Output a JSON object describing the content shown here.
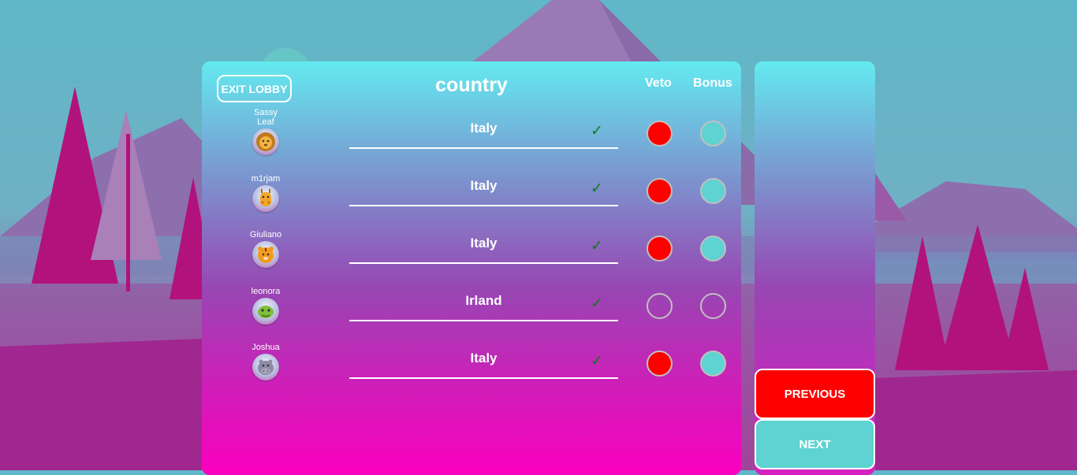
{
  "lobby": {
    "exit_label": "EXIT LOBBY"
  },
  "category": {
    "title": "country"
  },
  "columns": {
    "veto": "Veto",
    "bonus": "Bonus"
  },
  "players": [
    {
      "name": "Sassy\nLeaf",
      "avatar_icon": "lion-icon",
      "answer": "Italy",
      "accepted": true,
      "veto_active": true,
      "bonus_active": true
    },
    {
      "name": "m1rjam",
      "avatar_icon": "giraffe-icon",
      "answer": "Italy",
      "accepted": true,
      "veto_active": true,
      "bonus_active": true
    },
    {
      "name": "Giuliano",
      "avatar_icon": "tiger-icon",
      "answer": "Italy",
      "accepted": true,
      "veto_active": true,
      "bonus_active": true
    },
    {
      "name": "leonora",
      "avatar_icon": "turtle-icon",
      "answer": "Irland",
      "accepted": true,
      "veto_active": false,
      "bonus_active": false
    },
    {
      "name": "Joshua",
      "avatar_icon": "hippo-icon",
      "answer": "Italy",
      "accepted": true,
      "veto_active": true,
      "bonus_active": true
    }
  ],
  "check_symbol": "✓",
  "navigation": {
    "previous_label": "PREVIOUS",
    "next_label": "NEXT"
  },
  "colors": {
    "veto_active": "#ff0000",
    "bonus_active": "#5fd2d2",
    "check": "#0f7a19",
    "previous_button": "#ff0000",
    "next_button": "#5fd2d2"
  }
}
